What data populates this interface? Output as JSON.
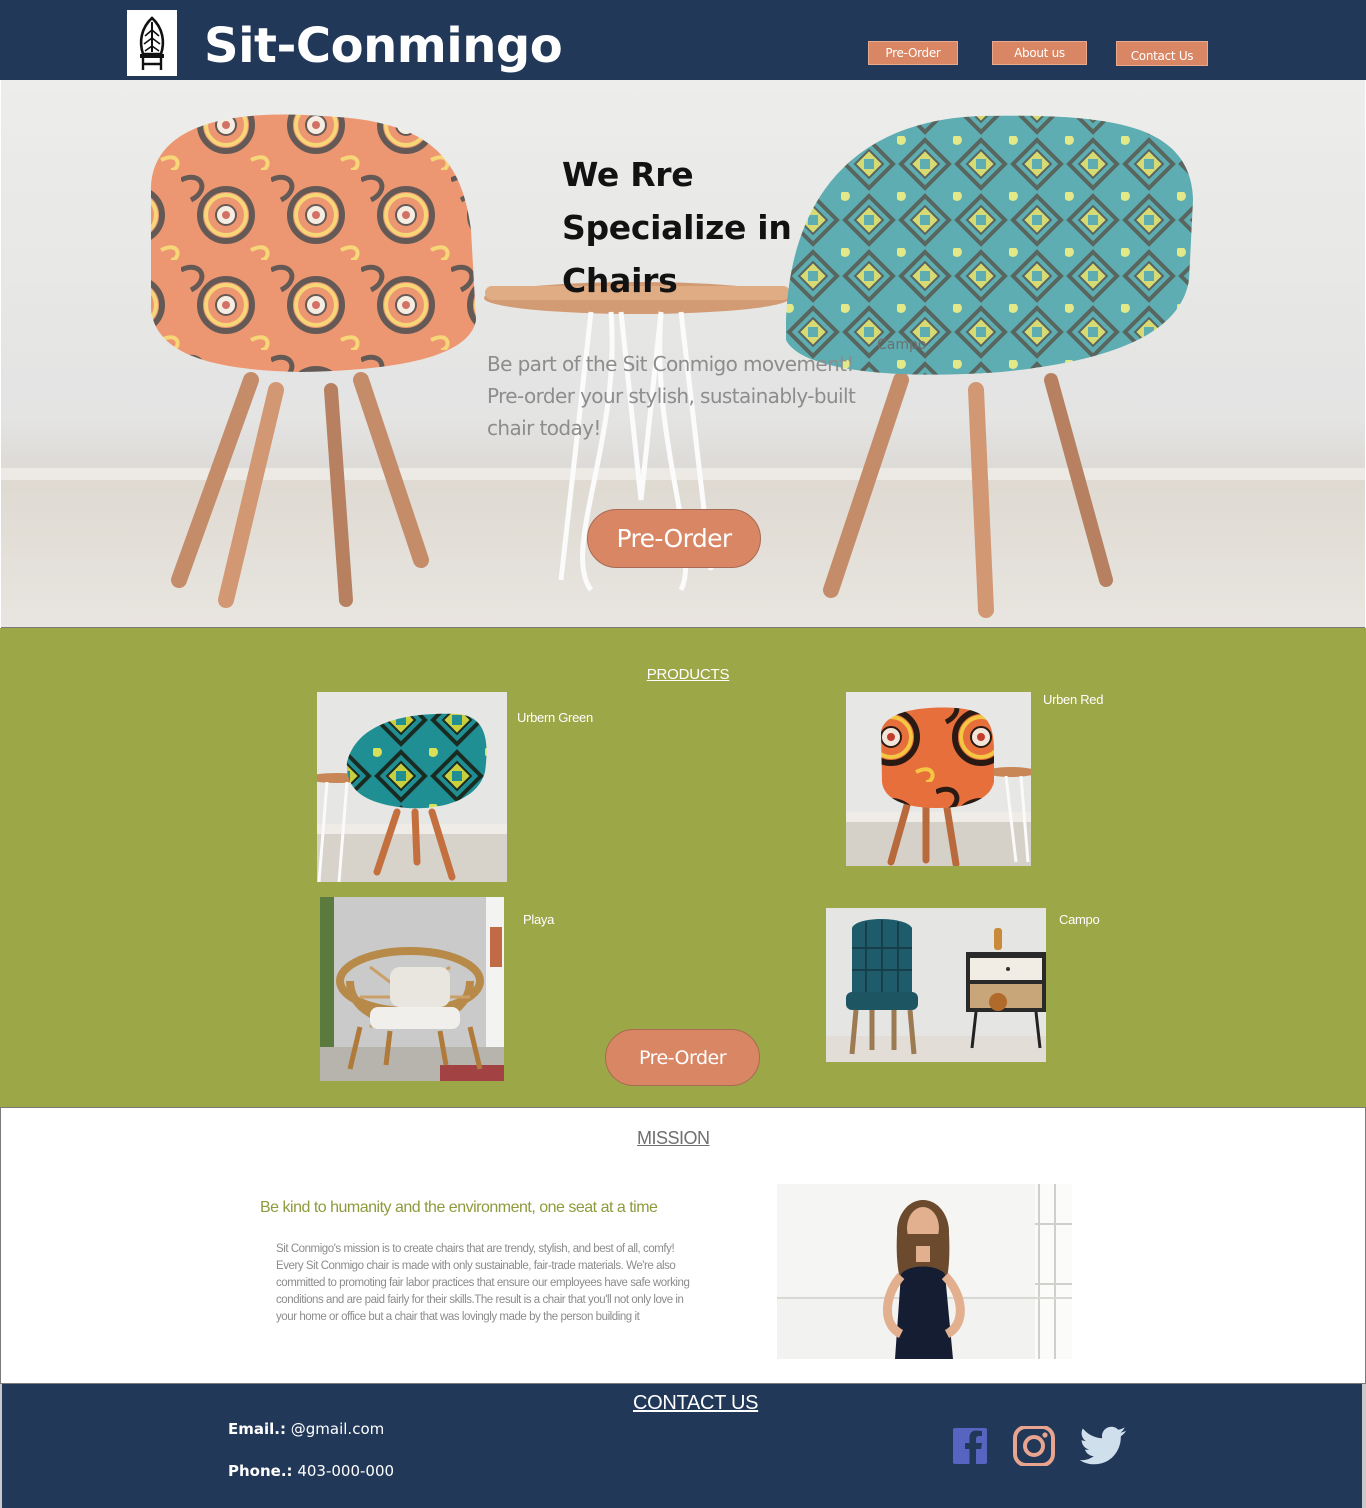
{
  "header": {
    "brand": "Sit-Conmingo",
    "logo_icon": "chair-logo-icon",
    "nav": [
      {
        "label": "Pre-Order"
      },
      {
        "label": "About us"
      },
      {
        "label": "Contact Us"
      }
    ]
  },
  "hero": {
    "title": "We Rre Specialize in Chairs",
    "subtitle": "Be part of the Sit Conmigo movement! Pre-order your stylish, sustainably-built chair today!",
    "stray_label": "Campo",
    "cta_label": "Pre-Order"
  },
  "products": {
    "title": "PRODUCTS",
    "items": [
      {
        "name": "Urbern Green"
      },
      {
        "name": "Urben Red"
      },
      {
        "name": "Playa"
      },
      {
        "name": "Campo"
      }
    ],
    "cta_label": "Pre-Order"
  },
  "mission": {
    "title": "MISSION",
    "tagline": "Be kind to humanity and the environment, one seat at a time",
    "body": "Sit Conmigo's mission is to create chairs that are trendy, stylish, and best of all, comfy! Every Sit Conmigo chair is made with only sustainable, fair-trade materials. We're also committed to promoting fair labor practices that ensure our employees have safe working conditions and are paid fairly for their skills.The result is a chair that you'll not only love in your home or office but a chair that was lovingly made by the person building it"
  },
  "contact": {
    "title": "CONTACT US",
    "email_label": "Email.:",
    "email_value": "@gmail.com",
    "phone_label": "Phone.:",
    "phone_value": "403-000-000",
    "social": [
      {
        "icon": "facebook-icon",
        "color": "#5865c0"
      },
      {
        "icon": "instagram-icon",
        "color": "#e8a48f"
      },
      {
        "icon": "twitter-icon",
        "color": "#cfe0ec"
      }
    ]
  },
  "colors": {
    "navy": "#213858",
    "accent": "#d98664",
    "olive": "#9ca748"
  }
}
